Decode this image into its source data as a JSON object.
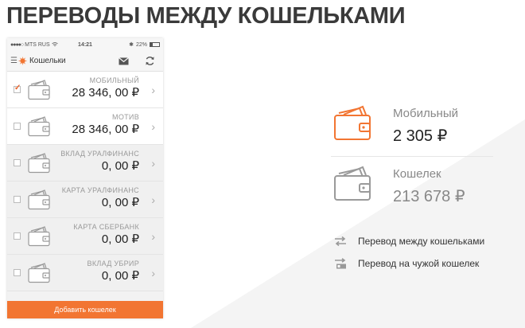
{
  "headline": "ПЕРЕВОДЫ МЕЖДУ КОШЕЛЬКАМИ",
  "phone": {
    "status": {
      "carrier": "MTS RUS",
      "time": "14:21",
      "battery": "22%"
    },
    "appbar": {
      "title": "Кошельки"
    },
    "rows": [
      {
        "name": "МОБИЛЬНЫЙ",
        "amount": "28 346, 00 ₽",
        "checked": true
      },
      {
        "name": "МОТИВ",
        "amount": "28 346, 00 ₽",
        "checked": false
      },
      {
        "name": "ВКЛАД УРАЛФИНАНС",
        "amount": "0, 00 ₽",
        "checked": false
      },
      {
        "name": "КАРТА УРАЛФИНАНС",
        "amount": "0, 00 ₽",
        "checked": false
      },
      {
        "name": "КАРТА СБЕРБАНК",
        "amount": "0, 00 ₽",
        "checked": false
      },
      {
        "name": "ВКЛАД УБРИР",
        "amount": "0, 00 ₽",
        "checked": false
      }
    ],
    "add_button": "Добавить кошелек"
  },
  "cards": [
    {
      "name": "Мобильный",
      "amount": "2 305  ₽"
    },
    {
      "name": "Кошелек",
      "amount": "213 678  ₽"
    }
  ],
  "legend": [
    {
      "label": "Перевод между кошельками",
      "icon": "transfer-arrows-icon"
    },
    {
      "label": "Перевод на чужой кошелек",
      "icon": "transfer-card-icon"
    }
  ],
  "colors": {
    "accent": "#f27532",
    "wallet_gray": "#9a9a9a"
  }
}
